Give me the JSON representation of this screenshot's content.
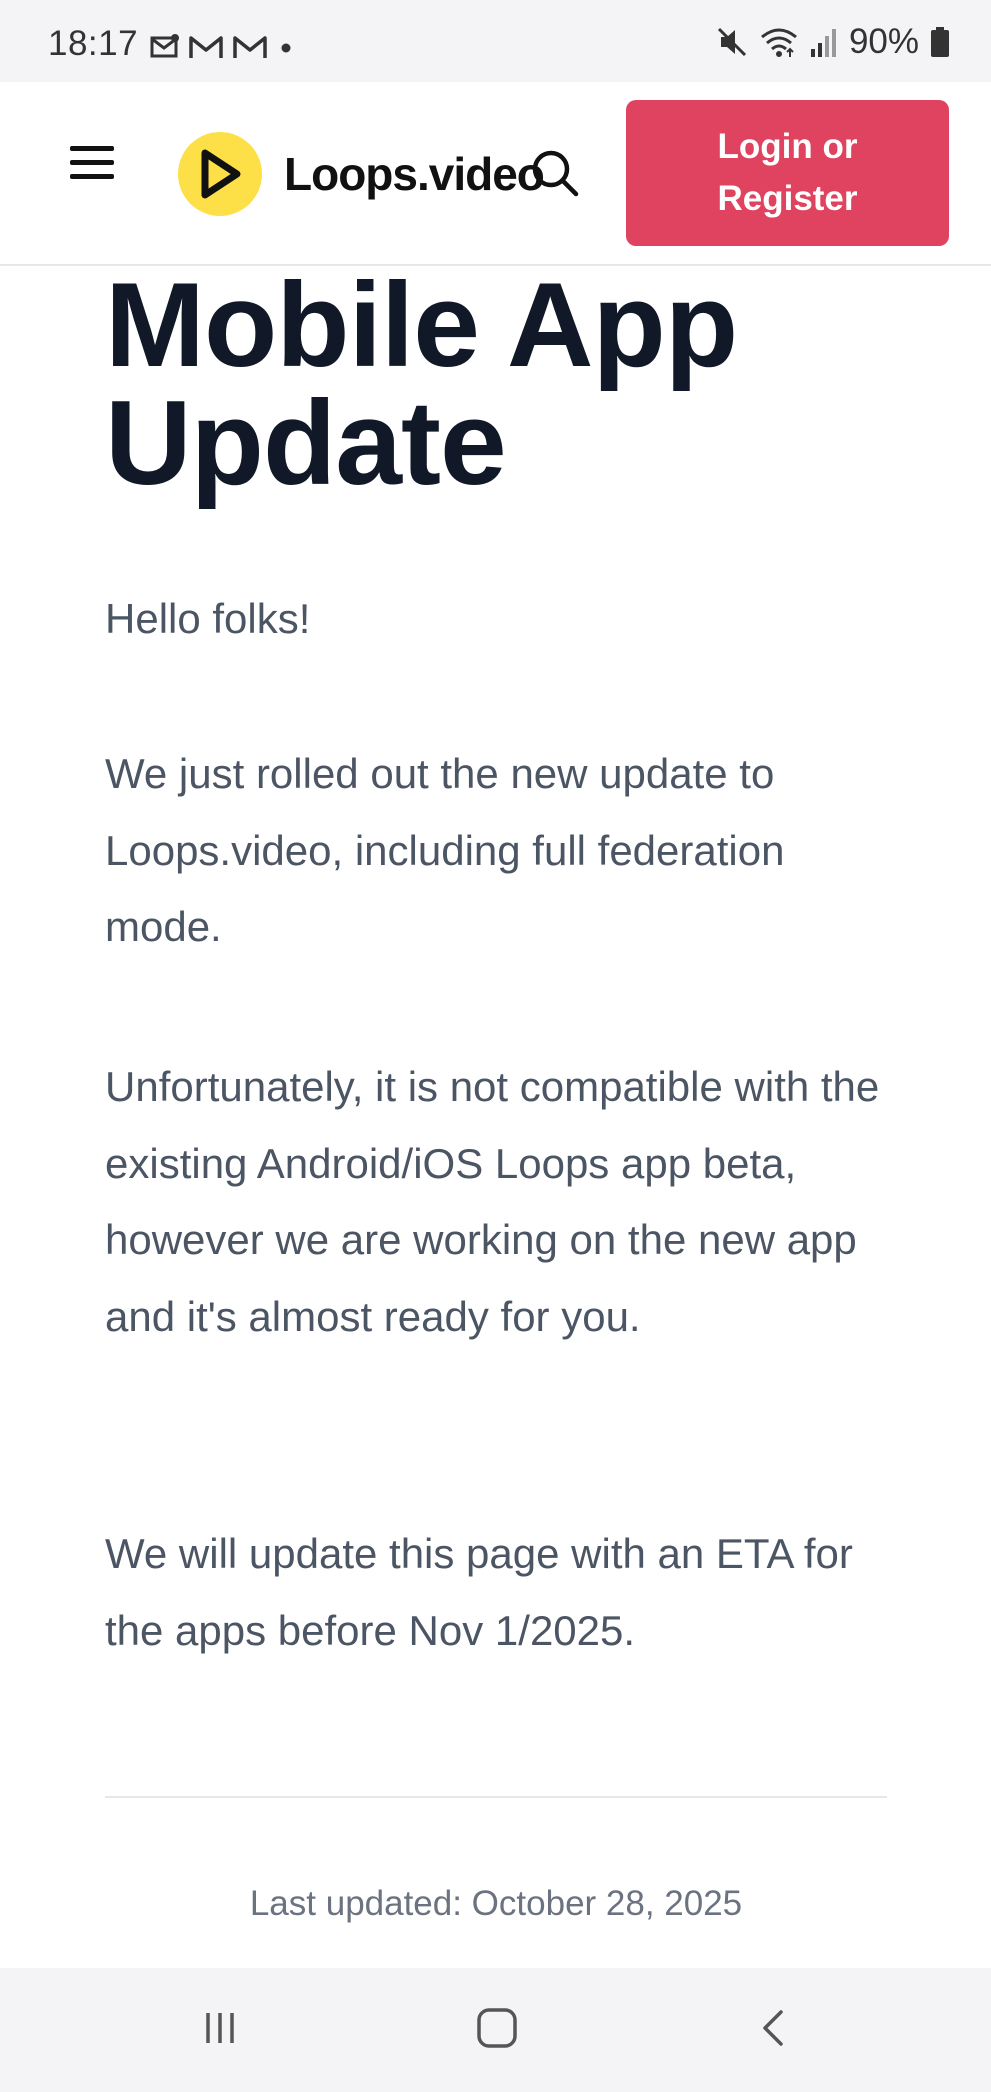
{
  "status_bar": {
    "time": "18:17",
    "battery": "90%",
    "left_icons": [
      "mail-icon",
      "gmail-icon",
      "gmail-icon",
      "dot-icon"
    ],
    "right_icons": [
      "mute-icon",
      "wifi-icon",
      "signal-icon",
      "battery-icon"
    ]
  },
  "header": {
    "logo_text": "Loops.video",
    "login_label": "Login or Register",
    "accent_color": "#e0435f",
    "logo_color": "#fde047"
  },
  "article": {
    "title": "Mobile App Update",
    "paragraphs": [
      "Hello folks!",
      "We just rolled out the new update to Loops.video, including full federation mode.",
      "Unfortunately, it is not compatible with the existing Android/iOS Loops app beta, however we are working on the new app and it's almost ready for you.",
      "We will update this page with an ETA for the apps before Nov 1/2025."
    ],
    "last_updated": "Last updated: October 28, 2025"
  },
  "nav_bar": {
    "buttons": [
      "recent-apps-icon",
      "home-icon",
      "back-icon"
    ]
  }
}
